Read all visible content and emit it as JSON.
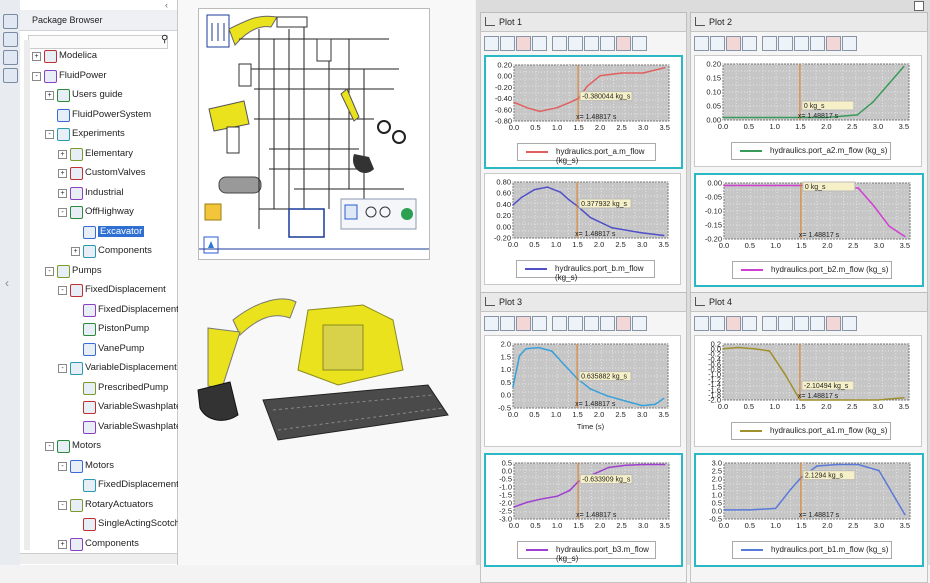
{
  "browser": {
    "title": "Package Browser",
    "tree": [
      {
        "label": "Modelica",
        "depth": 0,
        "exp": "+"
      },
      {
        "label": "FluidPower",
        "depth": 0,
        "exp": "-"
      },
      {
        "label": "Users guide",
        "depth": 1,
        "exp": "+"
      },
      {
        "label": "FluidPowerSystem",
        "depth": 1,
        "exp": ""
      },
      {
        "label": "Experiments",
        "depth": 1,
        "exp": "-"
      },
      {
        "label": "Elementary",
        "depth": 2,
        "exp": "+"
      },
      {
        "label": "CustomValves",
        "depth": 2,
        "exp": "+"
      },
      {
        "label": "Industrial",
        "depth": 2,
        "exp": "+"
      },
      {
        "label": "OffHighway",
        "depth": 2,
        "exp": "-"
      },
      {
        "label": "Excavator",
        "depth": 3,
        "exp": "",
        "selected": true
      },
      {
        "label": "Components",
        "depth": 3,
        "exp": "+"
      },
      {
        "label": "Pumps",
        "depth": 1,
        "exp": "-"
      },
      {
        "label": "FixedDisplacement",
        "depth": 2,
        "exp": "-"
      },
      {
        "label": "FixedDisplacementP",
        "depth": 3,
        "exp": ""
      },
      {
        "label": "PistonPump",
        "depth": 3,
        "exp": ""
      },
      {
        "label": "VanePump",
        "depth": 3,
        "exp": ""
      },
      {
        "label": "VariableDisplacement",
        "depth": 2,
        "exp": "-"
      },
      {
        "label": "PrescribedPump",
        "depth": 3,
        "exp": ""
      },
      {
        "label": "VariableSwashplate",
        "depth": 3,
        "exp": ""
      },
      {
        "label": "VariableSwashplate",
        "depth": 3,
        "exp": ""
      },
      {
        "label": "Motors",
        "depth": 1,
        "exp": "-"
      },
      {
        "label": "Motors",
        "depth": 2,
        "exp": "-"
      },
      {
        "label": "FixedDisplacementM",
        "depth": 3,
        "exp": ""
      },
      {
        "label": "RotaryActuators",
        "depth": 2,
        "exp": "-"
      },
      {
        "label": "SingleActingScotchY",
        "depth": 3,
        "exp": ""
      },
      {
        "label": "Components",
        "depth": 2,
        "exp": "+"
      }
    ]
  },
  "tabs": [
    "Plot 1",
    "Plot 2",
    "Plot 3",
    "Plot 4"
  ],
  "colors": {
    "highlight": "#2ab8c4",
    "cursor": "#e07a1a",
    "machine": "#e9e21c"
  },
  "plots": [
    {
      "legend": "hydraulics.port_a.m_flow (kg_s)",
      "color": "#e06060",
      "ticks": [
        "0.20",
        "0.00",
        "-0.20",
        "-0.40",
        "-0.60",
        "-0.80"
      ],
      "readout": "-0.380044 kg_s",
      "cursor": "x= 1.48817 s",
      "xlabel": ""
    },
    {
      "legend": "hydraulics.port_b.m_flow (kg_s)",
      "color": "#5050c8",
      "ticks": [
        "0.80",
        "0.60",
        "0.40",
        "0.20",
        "0.00",
        "-0.20"
      ],
      "readout": "0.377932 kg_s",
      "cursor": "x= 1.48817 s",
      "xlabel": ""
    },
    {
      "legend": "hydraulics.port_a2.m_flow (kg_s)",
      "color": "#3a9a5a",
      "ticks": [
        "0.20",
        "0.15",
        "0.10",
        "0.05",
        "0.00"
      ],
      "readout": "0 kg_s",
      "cursor": "x= 1.48817 s",
      "xlabel": ""
    },
    {
      "legend": "hydraulics.port_b2.m_flow (kg_s)",
      "color": "#d040d0",
      "ticks": [
        "0.00",
        "-0.05",
        "-0.10",
        "-0.15",
        "-0.20"
      ],
      "readout": "0 kg_s",
      "cursor": "x= 1.48817 s",
      "xlabel": ""
    },
    {
      "legend": "",
      "color": "#3aa0d8",
      "ticks": [
        "2.0",
        "1.5",
        "1.0",
        "0.5",
        "0.0",
        "-0.5"
      ],
      "readout": "0.635882 kg_s",
      "cursor": "x= 1.48817 s",
      "xlabel": "Time (s)"
    },
    {
      "legend": "hydraulics.port_b3.m_flow (kg_s)",
      "color": "#a040d0",
      "ticks": [
        "0.5",
        "0.0",
        "-0.5",
        "-1.0",
        "-1.5",
        "-2.0",
        "-2.5",
        "-3.0"
      ],
      "readout": "-0.633909 kg_s",
      "cursor": "x= 1.48817 s",
      "xlabel": ""
    },
    {
      "legend": "hydraulics.port_a1.m_flow (kg_s)",
      "color": "#a09030",
      "ticks": [
        "0.2",
        "0.0",
        "-0.2",
        "-0.4",
        "-0.6",
        "-0.8",
        "-1.0",
        "-1.2",
        "-1.4",
        "-1.6",
        "-1.8",
        "-2.0"
      ],
      "readout": "-2.10494 kg_s",
      "cursor": "x= 1.48817 s",
      "xlabel": ""
    },
    {
      "legend": "hydraulics.port_b1.m_flow (kg_s)",
      "color": "#5a7ad8",
      "ticks": [
        "3.0",
        "2.5",
        "2.0",
        "1.5",
        "1.0",
        "0.5",
        "0.0",
        "-0.5"
      ],
      "readout": "2.1294 kg_s",
      "cursor": "x= 1.48817 s",
      "xlabel": ""
    }
  ],
  "chart_data": [
    {
      "type": "line",
      "title": "",
      "xlabel": "",
      "ylabel": "",
      "xlim": [
        0,
        3.6
      ],
      "ylim": [
        -0.8,
        0.25
      ],
      "series": [
        {
          "name": "hydraulics.port_a.m_flow (kg_s)",
          "x": [
            0,
            0.3,
            0.6,
            1.0,
            1.3,
            1.49,
            1.7,
            2.0,
            2.5,
            3.0,
            3.5
          ],
          "y": [
            -0.45,
            -0.55,
            -0.62,
            -0.55,
            -0.45,
            -0.38,
            -0.15,
            0.05,
            0.1,
            0.1,
            0.2
          ]
        }
      ]
    },
    {
      "type": "line",
      "title": "",
      "xlabel": "",
      "ylabel": "",
      "xlim": [
        0,
        3.6
      ],
      "ylim": [
        -0.25,
        0.85
      ],
      "series": [
        {
          "name": "hydraulics.port_b.m_flow (kg_s)",
          "x": [
            0,
            0.2,
            0.5,
            0.8,
            1.1,
            1.3,
            1.49,
            1.8,
            2.3,
            3.0,
            3.5
          ],
          "y": [
            0.4,
            0.55,
            0.7,
            0.75,
            0.65,
            0.5,
            0.38,
            0.15,
            -0.05,
            -0.15,
            -0.2
          ]
        }
      ]
    },
    {
      "type": "line",
      "title": "",
      "xlabel": "",
      "ylabel": "",
      "xlim": [
        0,
        3.6
      ],
      "ylim": [
        -0.01,
        0.21
      ],
      "series": [
        {
          "name": "hydraulics.port_a2.m_flow (kg_s)",
          "x": [
            0,
            1.0,
            1.49,
            2.0,
            2.6,
            2.9,
            3.2,
            3.5
          ],
          "y": [
            0,
            0,
            0,
            0,
            0.01,
            0.06,
            0.13,
            0.2
          ]
        }
      ]
    },
    {
      "type": "line",
      "title": "",
      "xlabel": "",
      "ylabel": "",
      "xlim": [
        0,
        3.6
      ],
      "ylim": [
        -0.21,
        0.01
      ],
      "series": [
        {
          "name": "hydraulics.port_b2.m_flow (kg_s)",
          "x": [
            0,
            1.0,
            1.49,
            2.0,
            2.6,
            2.9,
            3.2,
            3.5
          ],
          "y": [
            0,
            0,
            0,
            0,
            -0.01,
            -0.08,
            -0.16,
            -0.2
          ]
        }
      ]
    },
    {
      "type": "line",
      "title": "",
      "xlabel": "Time (s)",
      "ylabel": "",
      "xlim": [
        0,
        3.6
      ],
      "ylim": [
        -0.6,
        2.1
      ],
      "series": [
        {
          "name": "",
          "x": [
            0,
            0.15,
            0.3,
            0.6,
            0.9,
            1.2,
            1.49,
            1.8,
            2.2,
            2.6,
            3.0,
            3.3,
            3.5
          ],
          "y": [
            0.3,
            1.6,
            1.9,
            1.95,
            1.8,
            1.2,
            0.64,
            0.2,
            -0.1,
            -0.3,
            -0.5,
            -0.45,
            -0.2
          ]
        }
      ]
    },
    {
      "type": "line",
      "title": "",
      "xlabel": "",
      "ylabel": "",
      "xlim": [
        0,
        3.6
      ],
      "ylim": [
        -3.1,
        0.6
      ],
      "series": [
        {
          "name": "hydraulics.port_b3.m_flow (kg_s)",
          "x": [
            0,
            0.3,
            0.6,
            1.0,
            1.3,
            1.49,
            1.8,
            2.2,
            2.6,
            3.0,
            3.5
          ],
          "y": [
            -2.3,
            -2.0,
            -1.8,
            -1.6,
            -1.2,
            -0.63,
            -0.2,
            0.3,
            0.45,
            0.5,
            0.5
          ]
        }
      ]
    },
    {
      "type": "line",
      "title": "",
      "xlabel": "",
      "ylabel": "",
      "xlim": [
        0,
        3.6
      ],
      "ylim": [
        -2.1,
        0.3
      ],
      "series": [
        {
          "name": "hydraulics.port_a1.m_flow (kg_s)",
          "x": [
            0,
            0.3,
            0.6,
            0.9,
            1.2,
            1.49,
            1.8,
            2.4,
            3.0,
            3.5
          ],
          "y": [
            0.1,
            0.15,
            0.1,
            0,
            -1.0,
            -2.1,
            -2.1,
            -2.1,
            -2.1,
            -2.0
          ]
        }
      ]
    },
    {
      "type": "line",
      "title": "",
      "xlabel": "",
      "ylabel": "",
      "xlim": [
        0,
        3.6
      ],
      "ylim": [
        -0.6,
        3.1
      ],
      "series": [
        {
          "name": "hydraulics.port_b1.m_flow (kg_s)",
          "x": [
            0,
            0.5,
            1.0,
            1.3,
            1.49,
            1.8,
            2.2,
            2.6,
            3.0,
            3.5
          ],
          "y": [
            0,
            0,
            0.1,
            1.4,
            2.13,
            2.9,
            3.0,
            3.0,
            2.6,
            -0.3
          ]
        }
      ]
    }
  ]
}
